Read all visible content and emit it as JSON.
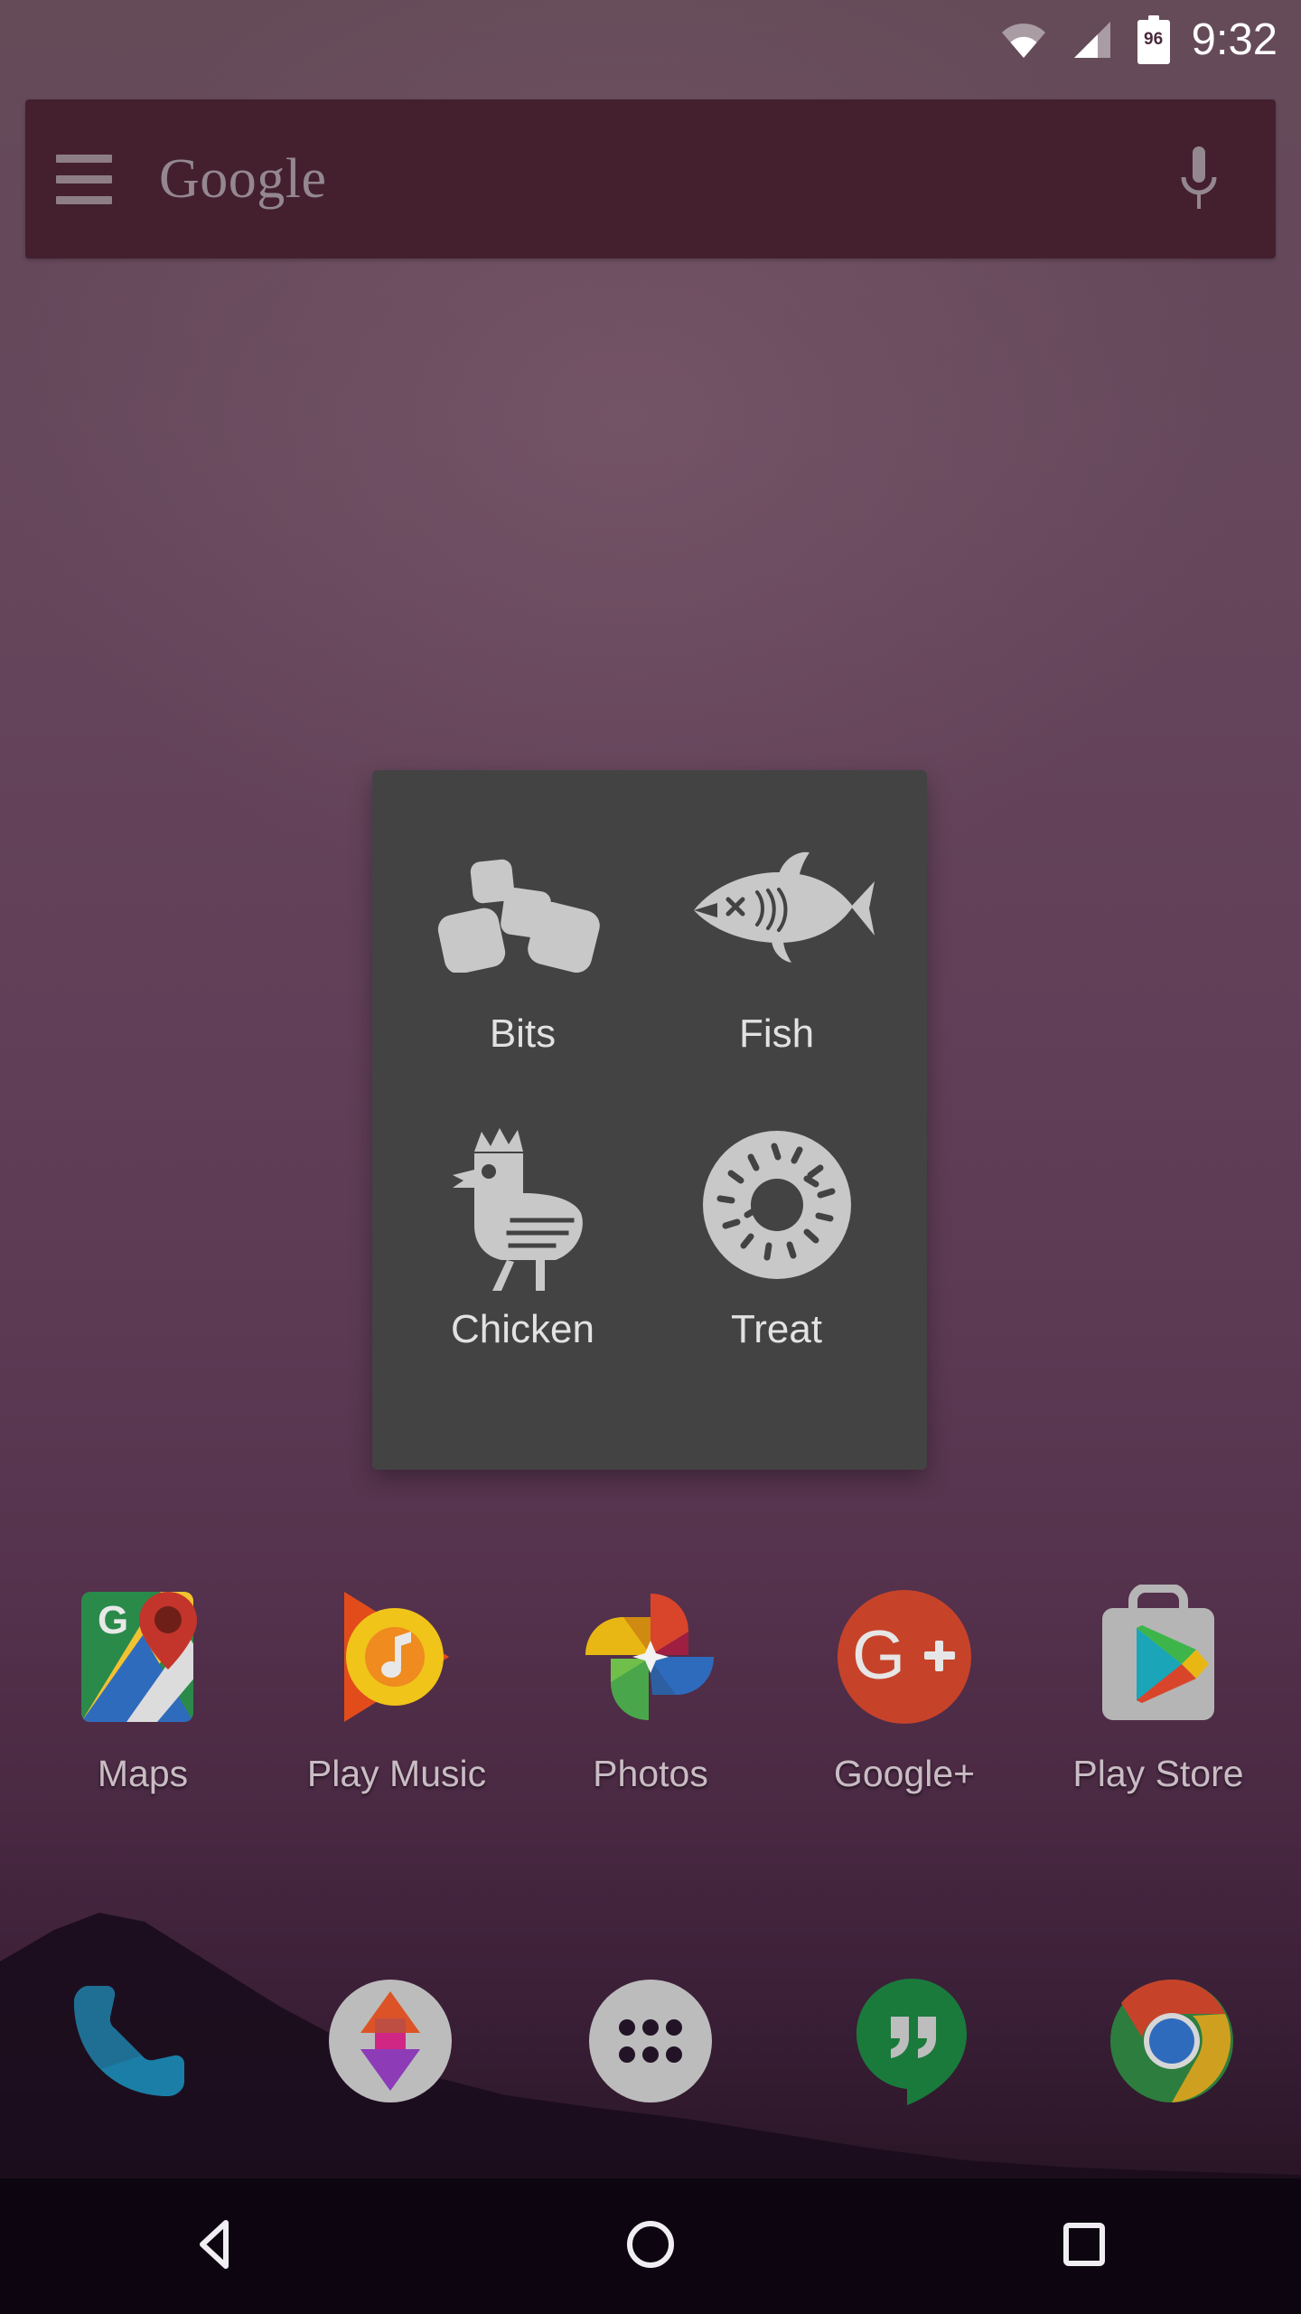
{
  "status_bar": {
    "time": "9:32",
    "battery_level": "96",
    "wifi_icon": "wifi-icon",
    "signal_icon": "cell-signal-icon",
    "battery_icon": "battery-icon"
  },
  "search_bar": {
    "menu_icon": "hamburger-menu-icon",
    "brand": "Google",
    "mic_icon": "microphone-icon",
    "background_color": "#44202f",
    "text_color": "#948790"
  },
  "food_panel": {
    "background_color": "#434343",
    "icon_color": "#c8c8c8",
    "label_color": "#e2e2e2",
    "items": [
      {
        "label": "Bits",
        "icon": "kibble-bits-icon"
      },
      {
        "label": "Fish",
        "icon": "fish-icon"
      },
      {
        "label": "Chicken",
        "icon": "chicken-icon"
      },
      {
        "label": "Treat",
        "icon": "donut-treat-icon"
      }
    ]
  },
  "app_row": {
    "apps": [
      {
        "label": "Maps",
        "icon": "google-maps-icon"
      },
      {
        "label": "Play Music",
        "icon": "play-music-icon"
      },
      {
        "label": "Photos",
        "icon": "google-photos-icon"
      },
      {
        "label": "Google+",
        "icon": "google-plus-icon"
      },
      {
        "label": "Play Store",
        "icon": "play-store-icon"
      }
    ]
  },
  "dock": {
    "items": [
      {
        "label": "Phone",
        "icon": "phone-icon"
      },
      {
        "label": "Snapseed",
        "icon": "snapseed-icon"
      },
      {
        "label": "All Apps",
        "icon": "app-drawer-icon"
      },
      {
        "label": "Hangouts",
        "icon": "hangouts-icon"
      },
      {
        "label": "Chrome",
        "icon": "chrome-icon"
      }
    ]
  },
  "nav_bar": {
    "background_color": "#0d0610",
    "buttons": [
      {
        "label": "Back",
        "icon": "back-triangle-icon"
      },
      {
        "label": "Home",
        "icon": "home-circle-icon"
      },
      {
        "label": "Recents",
        "icon": "recents-square-icon"
      }
    ]
  },
  "wallpaper": {
    "top_color": "#654b58",
    "bottom_color": "#1d0f1c",
    "hill_color": "#1b0d1d"
  }
}
